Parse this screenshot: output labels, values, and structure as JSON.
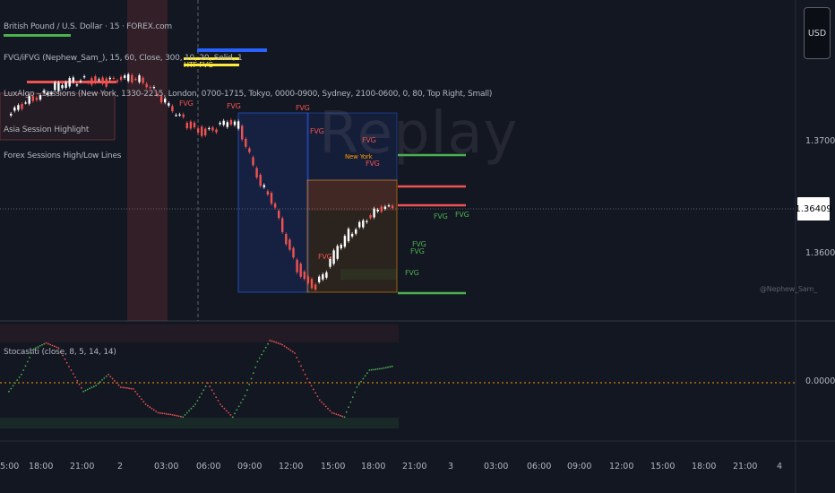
{
  "symbol_title": "British Pound / U.S. Dollar · 15 · FOREX.com",
  "indicators": {
    "fvg": "FVG/iFVG (Nephew_Sam_), 15, 60, Close, 300, 10, 20, Solid, 1",
    "fvg_tag": "HTF FVG",
    "sessions": "LuxAlgo - Sessions (New York, 1330-2215, London, 0700-1715, Tokyo, 0000-0900, Sydney, 2100-0600, 0, 80, Top Right, Small)",
    "asia": "Asia Session Highlight",
    "forex": "Forex Sessions High/Low Lines"
  },
  "oscillator_label": "Stocashti (close, 8, 5, 14, 14)",
  "currency": "USD",
  "price_axis": {
    "labels": [
      "1.37000",
      "1.36000"
    ],
    "current": "1.36409",
    "osc_zero": "0.00000"
  },
  "time_axis": [
    "5:00",
    "18:00",
    "21:00",
    "2",
    "03:00",
    "06:00",
    "09:00",
    "12:00",
    "15:00",
    "18:00",
    "21:00",
    "3",
    "03:00",
    "06:00",
    "09:00",
    "12:00",
    "15:00",
    "18:00",
    "21:00",
    "4"
  ],
  "fvg_marks": [
    "FVG",
    "FVG",
    "FVG",
    "FVG",
    "FVG",
    "FVG",
    "FVG",
    "FVG",
    "FVG",
    "FVG",
    "FVG",
    "FVG"
  ],
  "session_tag": "New York",
  "watermark": "Replay",
  "credit": "@Nephew_Sam_",
  "colors": {
    "bg": "#131722",
    "up": "#ffffff",
    "down": "#ef5350",
    "fvg": "#ef5350",
    "green": "#4caf50",
    "blue": "#2962ff",
    "yellow": "#ffeb3b",
    "osc_up": "#4caf50",
    "osc_down": "#ef5350",
    "orange": "#ff9800"
  },
  "chart_data": {
    "type": "line",
    "title": "British Pound / U.S. Dollar · 15 · FOREX.com",
    "ylabel": "",
    "xlabel": "",
    "ylim": [
      1.3575,
      1.375
    ],
    "series": [
      {
        "values": [
          1.3705,
          1.3712,
          1.3718,
          1.3722,
          1.3726,
          1.3729,
          1.3731,
          1.3732,
          1.3731,
          1.373,
          1.3731,
          1.3733,
          1.3733,
          1.3728,
          1.3719,
          1.371,
          1.3703,
          1.3697,
          1.3695,
          1.3698,
          1.3702,
          1.37,
          1.368,
          1.366,
          1.3648,
          1.3625,
          1.3605,
          1.3592,
          1.3588,
          1.36,
          1.3615,
          1.3625,
          1.3632,
          1.3638,
          1.3642,
          1.3641
        ]
      }
    ],
    "oscillator": {
      "values": [
        0.35,
        0.55,
        0.85,
        0.92,
        0.86,
        0.6,
        0.35,
        0.42,
        0.55,
        0.4,
        0.38,
        0.2,
        0.1,
        0.08,
        0.05,
        0.2,
        0.45,
        0.2,
        0.05,
        0.3,
        0.7,
        0.95,
        0.9,
        0.8,
        0.5,
        0.25,
        0.1,
        0.05,
        0.4,
        0.6,
        0.62,
        0.65
      ]
    }
  }
}
